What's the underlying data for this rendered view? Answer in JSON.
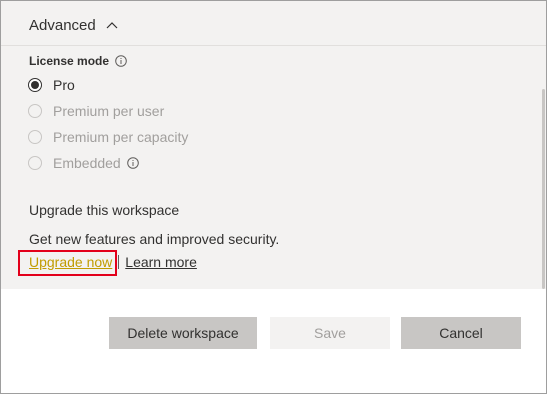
{
  "advanced": {
    "label": "Advanced"
  },
  "license": {
    "label": "License mode",
    "options": [
      {
        "label": "Pro",
        "selected": true,
        "disabled": false
      },
      {
        "label": "Premium per user",
        "selected": false,
        "disabled": true
      },
      {
        "label": "Premium per capacity",
        "selected": false,
        "disabled": true
      },
      {
        "label": "Embedded",
        "selected": false,
        "disabled": true
      }
    ]
  },
  "upgrade": {
    "title": "Upgrade this workspace",
    "description": "Get new features and improved security.",
    "upgrade_link": "Upgrade now",
    "learn_link": "Learn more"
  },
  "buttons": {
    "delete": "Delete workspace",
    "save": "Save",
    "cancel": "Cancel"
  },
  "colors": {
    "panel_bg": "#f3f2f1",
    "link_accent": "#c19c00",
    "highlight_border": "#e3001b"
  }
}
